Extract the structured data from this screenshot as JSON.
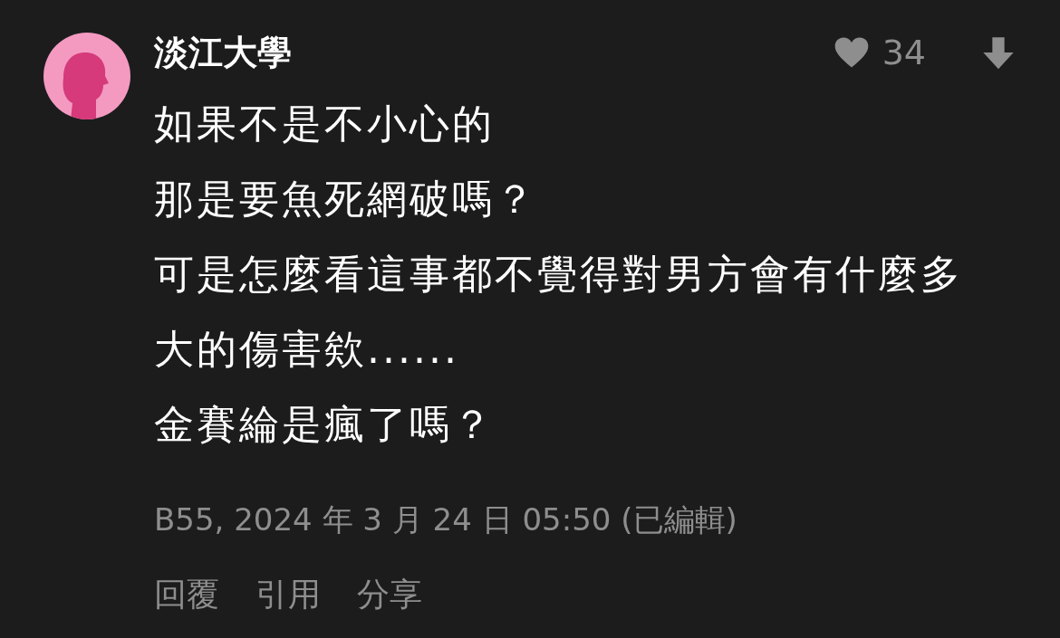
{
  "comment": {
    "author": "淡江大學",
    "likes": "34",
    "lines": [
      "如果不是不小心的",
      "那是要魚死網破嗎？",
      "可是怎麼看這事都不覺得對男方會有什麼多",
      "大的傷害欸......",
      "金賽綸是瘋了嗎？"
    ],
    "meta": "B55, 2024 年 3 月 24 日 05:50 (已編輯)",
    "actions": [
      "回覆",
      "引用",
      "分享"
    ]
  }
}
